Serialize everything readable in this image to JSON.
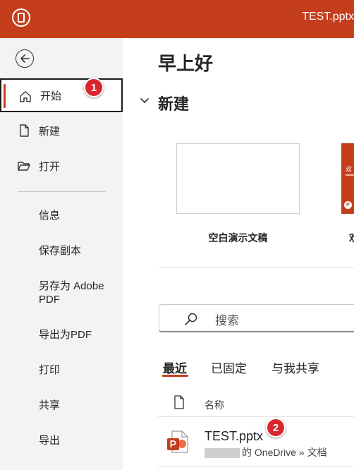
{
  "titlebar": {
    "title": "TEST.pptx",
    "app_icon": "powerpoint-logo-icon",
    "accent": "#c43e1c"
  },
  "sidebar": {
    "back_icon": "back-arrow-icon",
    "primary_items": [
      {
        "label": "开始",
        "icon": "home-icon",
        "active": true
      },
      {
        "label": "新建",
        "icon": "new-file-icon"
      },
      {
        "label": "打开",
        "icon": "open-folder-icon"
      }
    ],
    "secondary_items": [
      {
        "label": "信息"
      },
      {
        "label": "保存副本"
      },
      {
        "label": "另存为 Adobe PDF"
      },
      {
        "label": "导出为PDF"
      },
      {
        "label": "打印"
      },
      {
        "label": "共享"
      },
      {
        "label": "导出"
      }
    ]
  },
  "main": {
    "greeting": "早上好",
    "new_section": {
      "title": "新建",
      "templates": [
        {
          "label": "空白演示文稿"
        },
        {
          "label": "欢",
          "thumb_text": "欢",
          "thumb_color": "#c43e1c"
        }
      ]
    },
    "search": {
      "placeholder": "搜索"
    },
    "tabs": [
      {
        "label": "最近",
        "active": true
      },
      {
        "label": "已固定"
      },
      {
        "label": "与我共享"
      }
    ],
    "files_header": {
      "name": "名称"
    },
    "files": [
      {
        "name": "TEST.pptx",
        "location_suffix": "的 OneDrive » 文档"
      }
    ]
  },
  "annotations": [
    {
      "number": "1"
    },
    {
      "number": "2"
    }
  ],
  "colors": {
    "accent": "#c43e1c",
    "badge": "#d9262e",
    "sidebar_bg": "#f3f3f3"
  }
}
